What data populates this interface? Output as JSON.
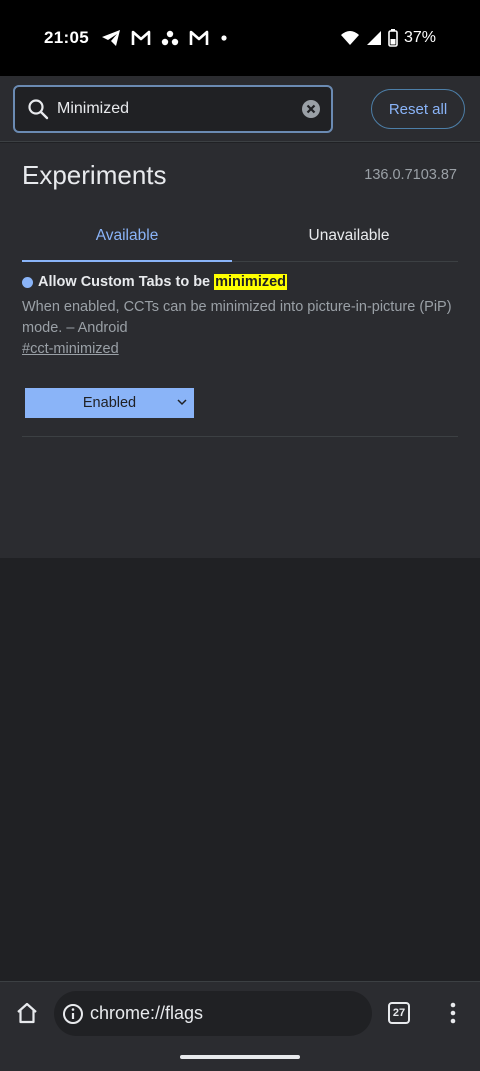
{
  "status_bar": {
    "time": "21:05",
    "battery": "37%",
    "icons": [
      "telegram-icon",
      "gmail-icon",
      "dots-cluster-icon",
      "gmail-icon",
      "notification-dot-icon",
      "wifi-icon",
      "cell-signal-icon",
      "battery-icon"
    ]
  },
  "search": {
    "value": "Minimized",
    "placeholder": "Search flags",
    "reset_label": "Reset all"
  },
  "page": {
    "title": "Experiments",
    "version": "136.0.7103.87"
  },
  "tabs": [
    {
      "label": "Available",
      "active": true
    },
    {
      "label": "Unavailable",
      "active": false
    }
  ],
  "flag": {
    "title_prefix": "Allow Custom Tabs to be",
    "title_highlight": "minimized",
    "description": "When enabled, CCTs can be minimized into picture-in-picture (PiP) mode. – Android",
    "link": "#cct-minimized",
    "state": "Enabled"
  },
  "bottom_bar": {
    "url": "chrome://flags",
    "tab_count": "27"
  },
  "colors": {
    "accent": "#8ab4f8",
    "highlight": "#ffff00",
    "panel": "#2b2c30",
    "background": "#202124"
  }
}
